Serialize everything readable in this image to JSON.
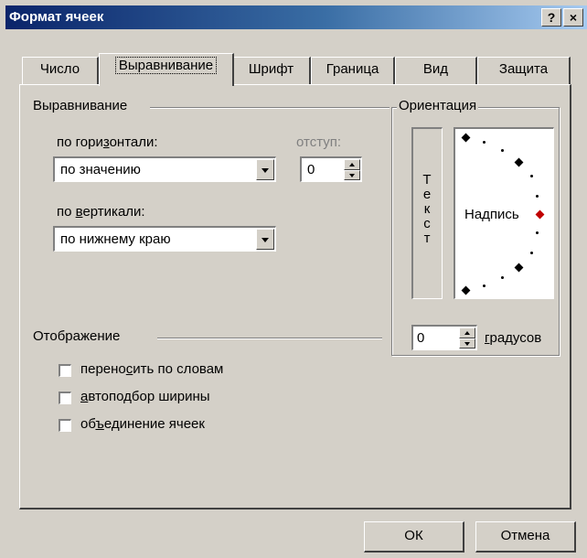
{
  "window": {
    "title": "Формат ячеек",
    "help_btn": "?",
    "close_btn": "×"
  },
  "tabs": [
    {
      "label": "Число",
      "active": false
    },
    {
      "label": "Выравнивание",
      "active": true
    },
    {
      "label": "Шрифт",
      "active": false
    },
    {
      "label": "Граница",
      "active": false
    },
    {
      "label": "Вид",
      "active": false
    },
    {
      "label": "Защита",
      "active": false
    }
  ],
  "alignment": {
    "group_label": "Выравнивание",
    "horizontal": {
      "label_pre": "по гори",
      "label_ul": "з",
      "label_post": "онтали:",
      "value": "по значению"
    },
    "indent": {
      "label": "отступ:",
      "value": "0"
    },
    "vertical": {
      "label_pre": "по ",
      "label_ul": "в",
      "label_post": "ертикали:",
      "value": "по нижнему краю"
    }
  },
  "orientation": {
    "group_label": "Ориентация",
    "vertical_text": [
      "Т",
      "е",
      "к",
      "с",
      "т"
    ],
    "inscription": "Надпись",
    "degrees_value": "0",
    "degrees_ul": "г",
    "degrees_rest": "радусов"
  },
  "display": {
    "group_label": "Отображение",
    "wrap": {
      "pre": "перено",
      "ul": "с",
      "post": "ить по словам",
      "checked": false
    },
    "autofit": {
      "pre": "",
      "ul": "а",
      "post": "втоподбор ширины",
      "checked": false
    },
    "merge": {
      "pre": "об",
      "ul": "ъ",
      "post": "единение ячеек",
      "checked": false
    }
  },
  "buttons": {
    "ok": "ОК",
    "cancel": "Отмена"
  },
  "colors": {
    "title_start": "#0a246a",
    "title_end": "#a6caf0",
    "face": "#d4d0c8",
    "accent_marker": "#c00000"
  }
}
